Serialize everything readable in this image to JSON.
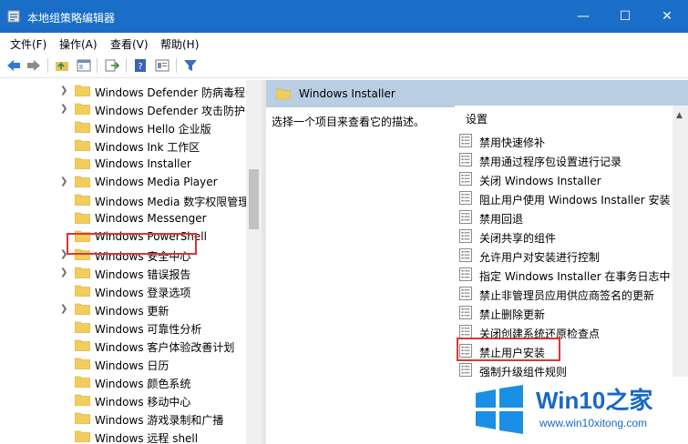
{
  "window": {
    "title": "本地组策略编辑器",
    "controls": {
      "minimize": "—",
      "maximize": "☐",
      "close": "✕"
    }
  },
  "menu": [
    "文件(F)",
    "操作(A)",
    "查看(V)",
    "帮助(H)"
  ],
  "tree": {
    "items": [
      {
        "label": "Windows Defender 防病毒程",
        "expandable": true
      },
      {
        "label": "Windows Defender 攻击防护",
        "expandable": true
      },
      {
        "label": "Windows Hello 企业版",
        "expandable": false
      },
      {
        "label": "Windows Ink 工作区",
        "expandable": false
      },
      {
        "label": "Windows Installer",
        "expandable": false,
        "selected": true
      },
      {
        "label": "Windows Media Player",
        "expandable": true
      },
      {
        "label": "Windows Media 数字权限管理",
        "expandable": false
      },
      {
        "label": "Windows Messenger",
        "expandable": false
      },
      {
        "label": "Windows PowerShell",
        "expandable": false
      },
      {
        "label": "Windows 安全中心",
        "expandable": true
      },
      {
        "label": "Windows 错误报告",
        "expandable": true
      },
      {
        "label": "Windows 登录选项",
        "expandable": false
      },
      {
        "label": "Windows 更新",
        "expandable": true
      },
      {
        "label": "Windows 可靠性分析",
        "expandable": false
      },
      {
        "label": "Windows 客户体验改善计划",
        "expandable": false
      },
      {
        "label": "Windows 日历",
        "expandable": false
      },
      {
        "label": "Windows 颜色系统",
        "expandable": false
      },
      {
        "label": "Windows 移动中心",
        "expandable": false
      },
      {
        "label": "Windows 游戏录制和广播",
        "expandable": false
      },
      {
        "label": "Windows 远程 shell",
        "expandable": false
      }
    ]
  },
  "right": {
    "header_title": "Windows Installer",
    "description": "选择一个项目来查看它的描述。",
    "column_header": "设置",
    "settings": [
      "禁用快速修补",
      "禁用通过程序包设置进行记录",
      "关闭 Windows Installer",
      "阻止用户使用 Windows Installer 安装",
      "禁用回退",
      "关闭共享的组件",
      "允许用户对安装进行控制",
      "指定 Windows Installer 在事务日志中",
      "禁止非管理员应用供应商签名的更新",
      "禁止删除更新",
      "关闭创建系统还原检查点",
      "禁止用户安装",
      "强制升级组件规则"
    ]
  },
  "watermark": {
    "brand": "Win10之家",
    "url": "www.win10xitong.com"
  },
  "colors": {
    "titlebar": "#1a6ec7",
    "highlight": "#d7383a",
    "header": "#b9cde3"
  }
}
